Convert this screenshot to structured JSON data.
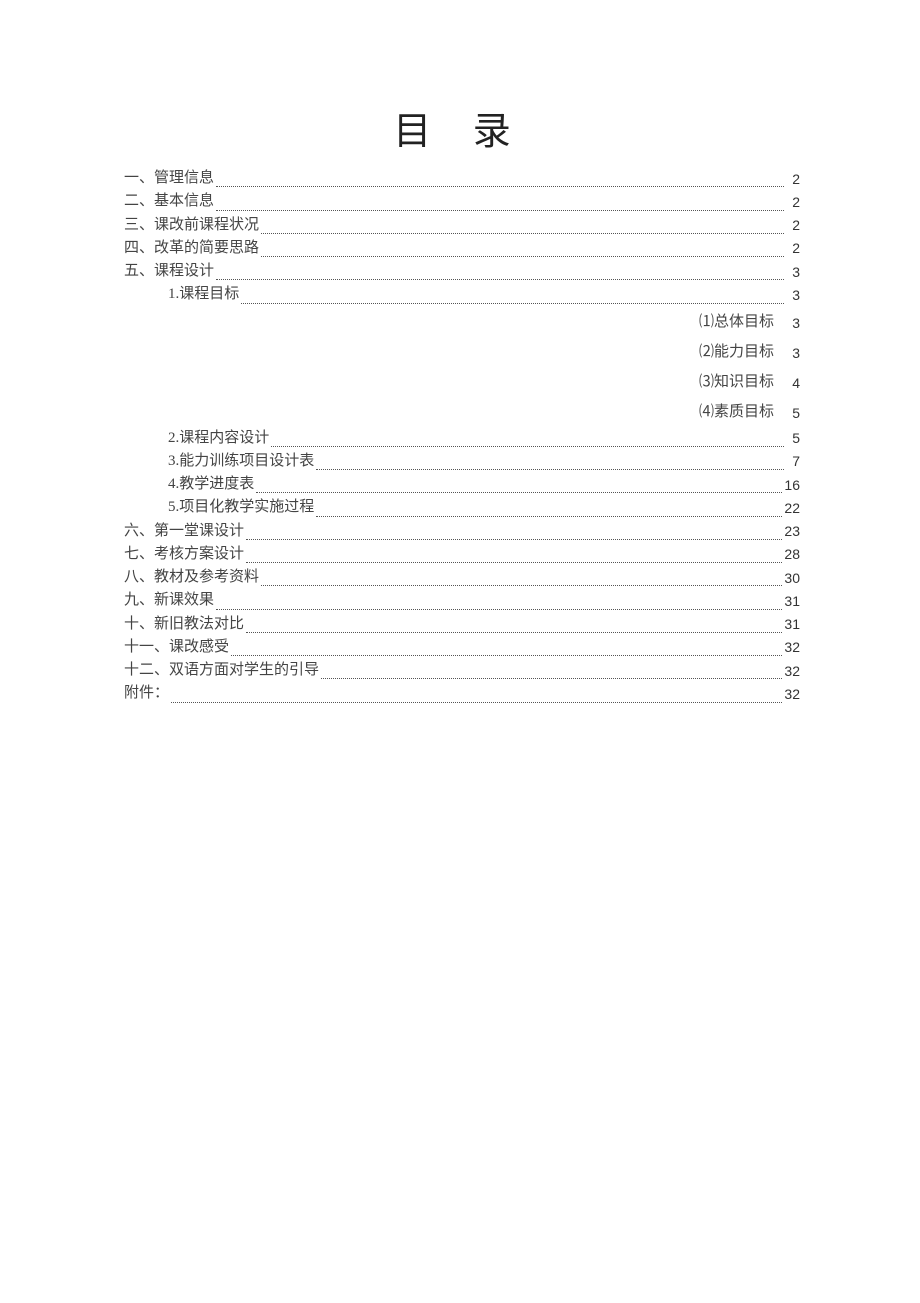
{
  "title": "目 录",
  "toc": [
    {
      "label": "一、管理信息",
      "page": "2",
      "level": 1
    },
    {
      "label": "二、基本信息",
      "page": "2",
      "level": 1
    },
    {
      "label": "三、课改前课程状况",
      "page": "2",
      "level": 1
    },
    {
      "label": "四、改革的简要思路",
      "page": "2",
      "level": 1
    },
    {
      "label": "五、课程设计",
      "page": "3",
      "level": 1
    },
    {
      "label": "1.课程目标",
      "page": "3",
      "level": 2
    },
    {
      "label": "⑴总体目标",
      "page": "3",
      "level": 3
    },
    {
      "label": "⑵能力目标",
      "page": "3",
      "level": 3
    },
    {
      "label": "⑶知识目标",
      "page": "4",
      "level": 3
    },
    {
      "label": "⑷素质目标",
      "page": "5",
      "level": 3
    },
    {
      "label": "2.课程内容设计",
      "page": "5",
      "level": 2
    },
    {
      "label": "3.能力训练项目设计表",
      "page": "7",
      "level": 2
    },
    {
      "label": "4.教学进度表",
      "page": "16",
      "level": 2
    },
    {
      "label": "5.项目化教学实施过程",
      "page": "22",
      "level": 2
    },
    {
      "label": "六、第一堂课设计",
      "page": "23",
      "level": 1
    },
    {
      "label": "七、考核方案设计",
      "page": "28",
      "level": 1
    },
    {
      "label": "八、教材及参考资料",
      "page": "30",
      "level": 1
    },
    {
      "label": "九、新课效果",
      "page": "31",
      "level": 1
    },
    {
      "label": "十、新旧教法对比",
      "page": "31",
      "level": 1
    },
    {
      "label": "十一、课改感受",
      "page": "32",
      "level": 1
    },
    {
      "label": "十二、双语方面对学生的引导",
      "page": "32",
      "level": 1
    },
    {
      "label": "附件：",
      "page": "32",
      "level": 1
    }
  ]
}
